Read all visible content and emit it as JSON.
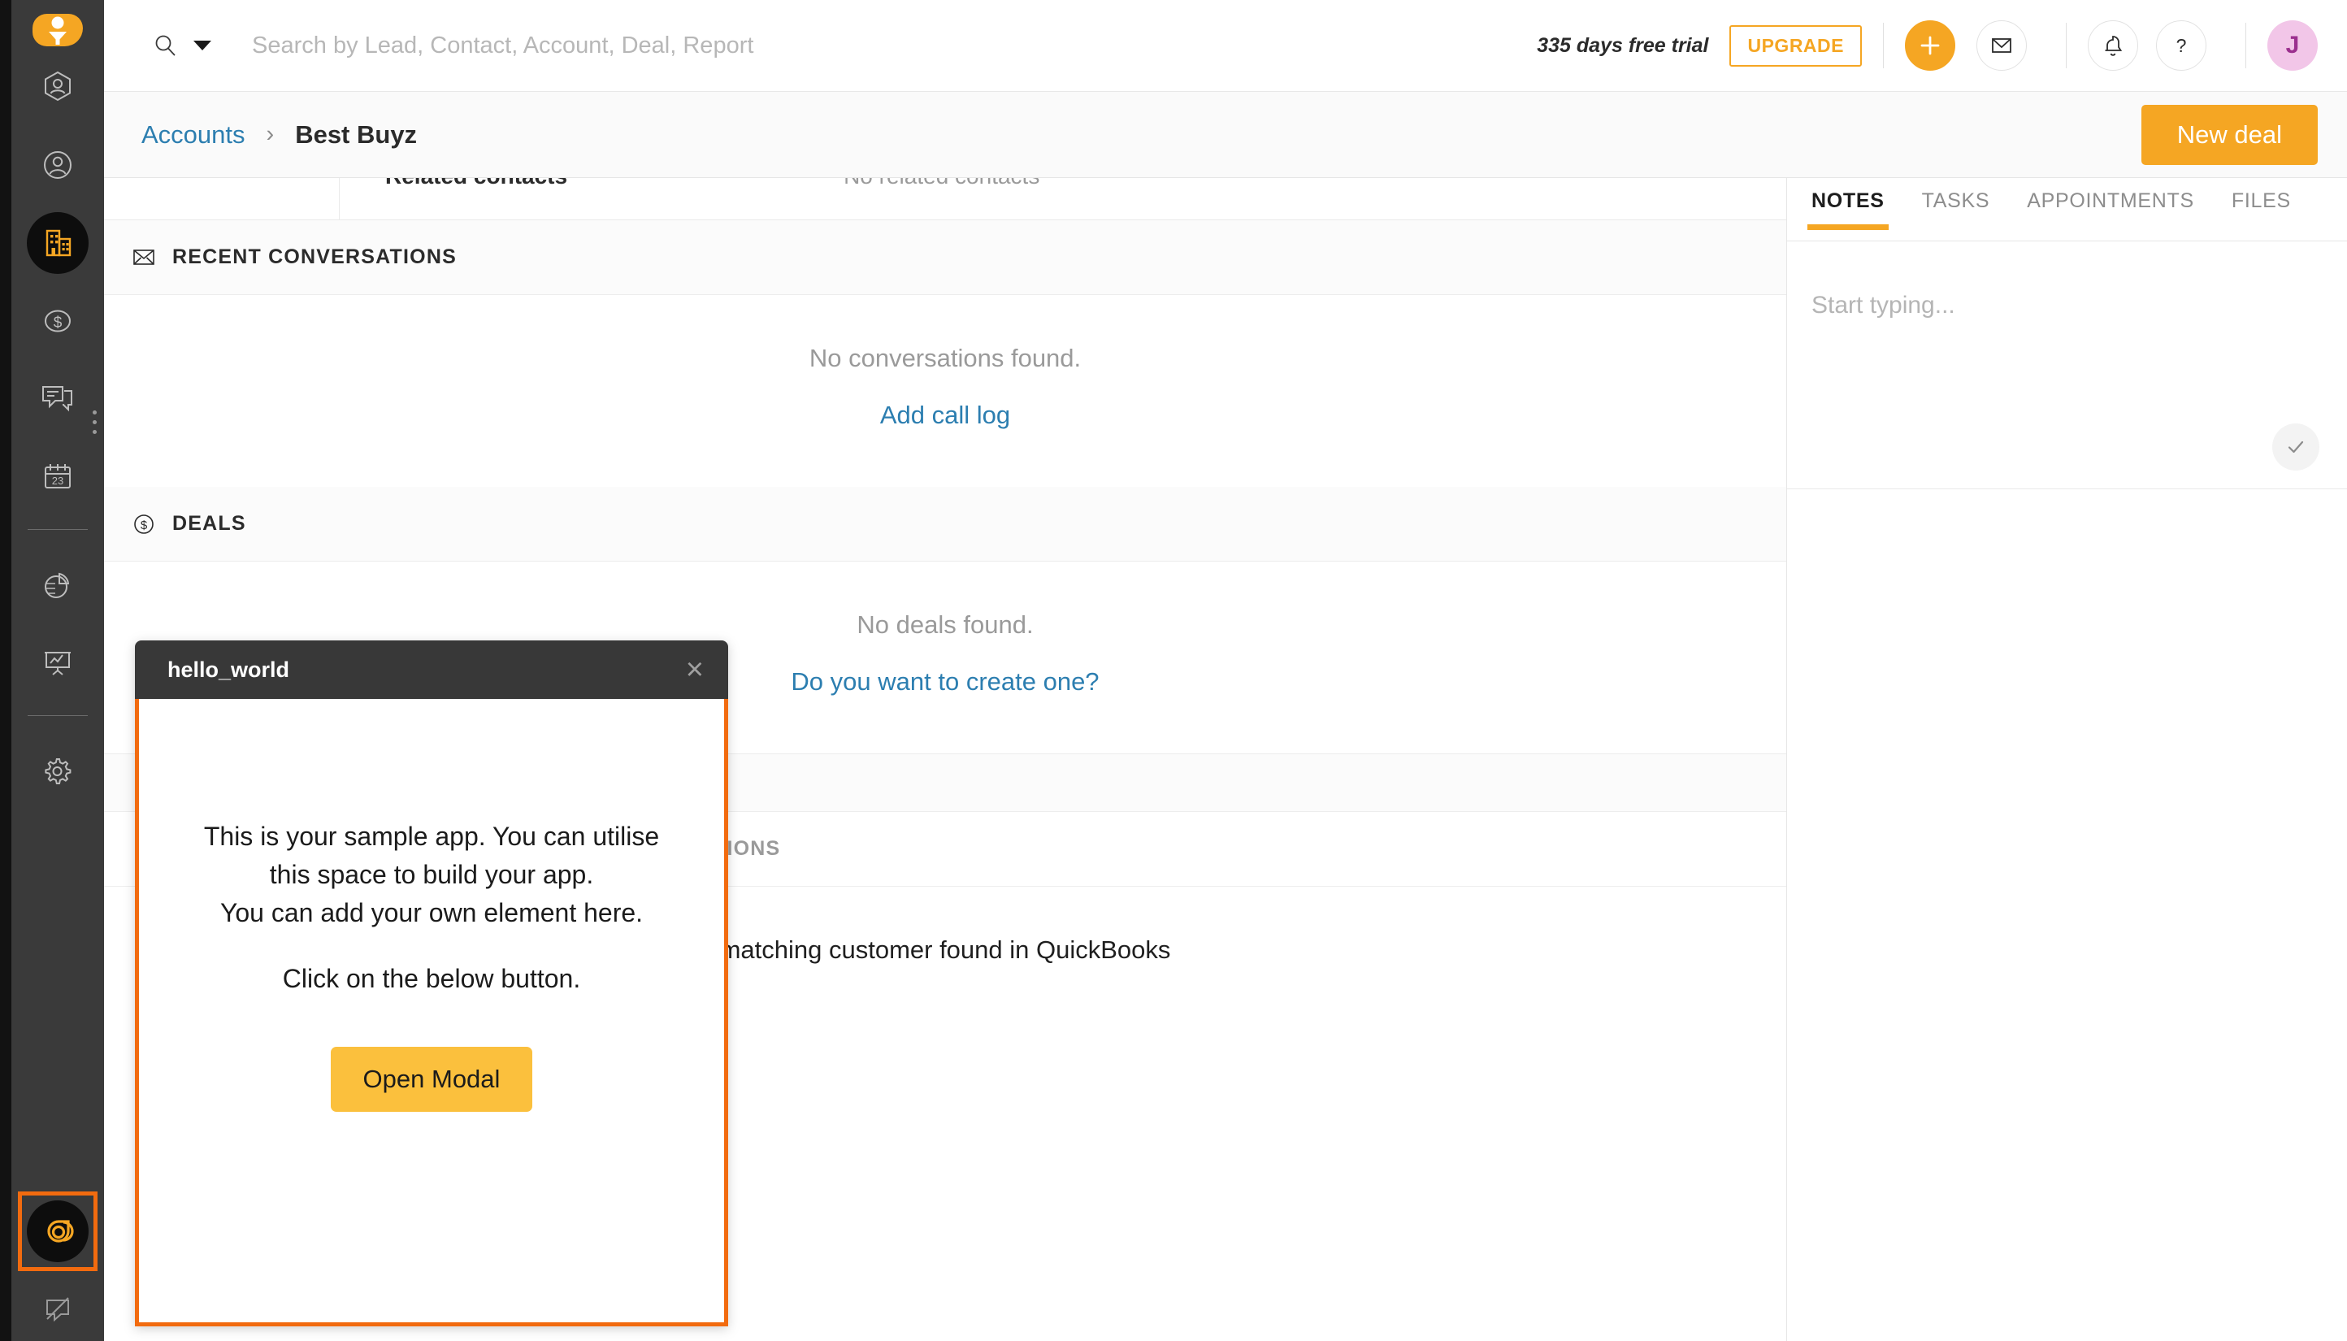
{
  "brand": {
    "accent": "#f5a623",
    "highlight": "#f26b0f",
    "link": "#2c7eb0",
    "rail_bg": "#3a3a3a"
  },
  "topbar": {
    "search_placeholder": "Search by Lead, Contact, Account, Deal, Report",
    "search_value": "",
    "trial_text": "335 days free trial",
    "upgrade_label": "UPGRADE",
    "avatar_initial": "J"
  },
  "rail": {
    "items": [
      {
        "name": "leads",
        "icon": "lead-hexagon-icon",
        "active": false
      },
      {
        "name": "contacts",
        "icon": "contact-person-icon",
        "active": false
      },
      {
        "name": "accounts",
        "icon": "accounts-building-icon",
        "active": true
      },
      {
        "name": "deals",
        "icon": "deals-dollar-icon",
        "active": false
      },
      {
        "name": "conversations",
        "icon": "conversations-chat-icon",
        "active": false
      },
      {
        "name": "calendar",
        "icon": "calendar-23-icon",
        "active": false
      },
      {
        "name": "reports",
        "icon": "reports-pie-icon",
        "active": false
      },
      {
        "name": "dashboard",
        "icon": "dashboard-presentation-icon",
        "active": false
      },
      {
        "name": "settings",
        "icon": "settings-gear-icon",
        "active": false
      },
      {
        "name": "sample-app",
        "icon": "sample-app-spiral-icon",
        "active": false
      },
      {
        "name": "feedback",
        "icon": "feedback-chat-slash-icon",
        "active": false
      }
    ]
  },
  "breadcrumb": {
    "parent": "Accounts",
    "separator": "›",
    "current": "Best Buyz",
    "new_deal_label": "New deal"
  },
  "main": {
    "related_contacts_label": "Related contacts",
    "related_contacts_value": "No related contacts",
    "sections": [
      {
        "id": "recent-conversations",
        "icon": "envelope-icon",
        "title": "RECENT CONVERSATIONS",
        "empty_message": "No conversations found.",
        "empty_link": "Add call log"
      },
      {
        "id": "deals",
        "icon": "dollar-circle-icon",
        "title": "DEALS",
        "empty_message": "No deals found.",
        "empty_link": "Do you want to create one?"
      }
    ],
    "quickbooks_section_title_fragment": "TIONS",
    "quickbooks_message_fragment": "matching customer found in QuickBooks"
  },
  "right_panel": {
    "tabs": [
      {
        "label": "NOTES",
        "active": true
      },
      {
        "label": "TASKS",
        "active": false
      },
      {
        "label": "APPOINTMENTS",
        "active": false
      },
      {
        "label": "FILES",
        "active": false
      }
    ],
    "note_placeholder": "Start typing...",
    "note_value": ""
  },
  "modal": {
    "title": "hello_world",
    "close_label": "×",
    "line1": "This is your sample app. You can utilise",
    "line2": "this space to build your app.",
    "line3": "You can add your own element here.",
    "line4": "Click on the below button.",
    "button_label": "Open Modal"
  }
}
